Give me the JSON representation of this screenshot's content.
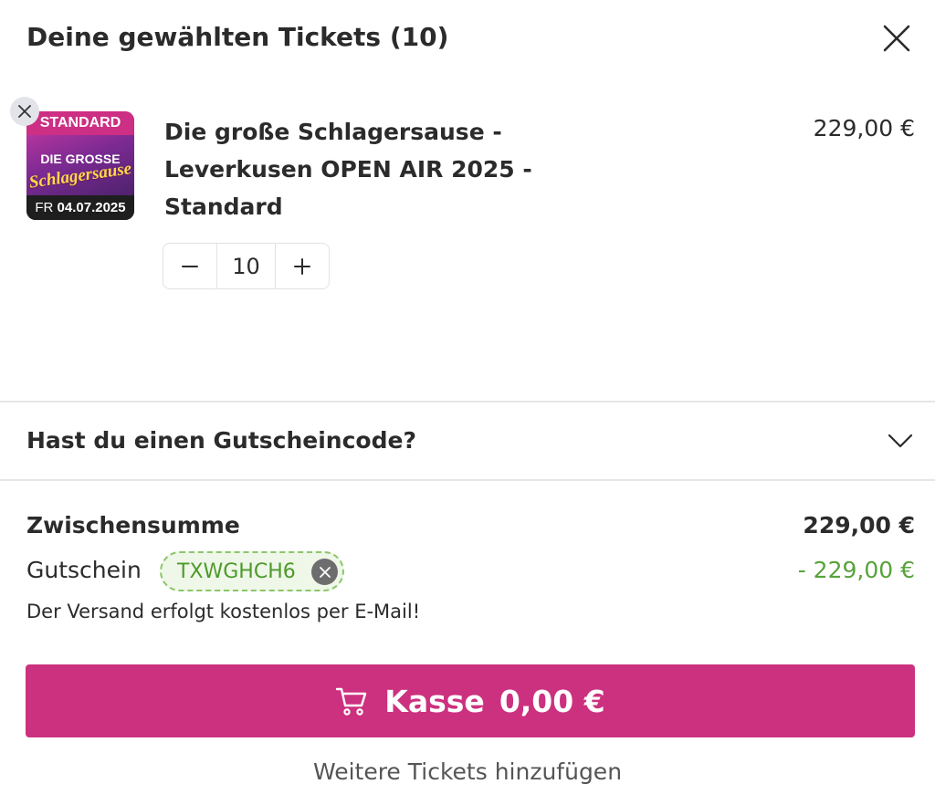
{
  "header": {
    "title": "Deine gewählten Tickets (10)",
    "close_icon": "close-icon"
  },
  "item": {
    "thumbnail": {
      "badge": "STANDARD",
      "logo_line1": "DIE GROSSE",
      "logo_line2": "Schlagersause",
      "date_prefix": "FR",
      "date": "04.07.2025"
    },
    "name": "Die große Schlagersause - Leverkusen OPEN AIR 2025 - Standard",
    "price": "229,00 €",
    "quantity": "10",
    "remove_icon": "close-icon",
    "decrease_icon": "minus-icon",
    "increase_icon": "plus-icon"
  },
  "voucher_section": {
    "label": "Hast du einen Gutscheincode?",
    "toggle_icon": "chevron-down-icon"
  },
  "summary": {
    "subtotal_label": "Zwischensumme",
    "subtotal_value": "229,00 €",
    "voucher_label": "Gutschein",
    "voucher_code": "TXWGHCH6",
    "voucher_discount": "-  229,00 €",
    "shipping_note": "Der Versand erfolgt kostenlos per E-Mail!"
  },
  "checkout": {
    "label": "Kasse",
    "amount": "0,00 €",
    "icon": "cart-icon"
  },
  "more_tickets_label": "Weitere Tickets hinzufügen",
  "colors": {
    "brand": "#cc317f",
    "voucher_green": "#58a33b",
    "chip_border": "#8cc56a",
    "text": "#2b2b2b",
    "divider": "#e6e6e6"
  }
}
